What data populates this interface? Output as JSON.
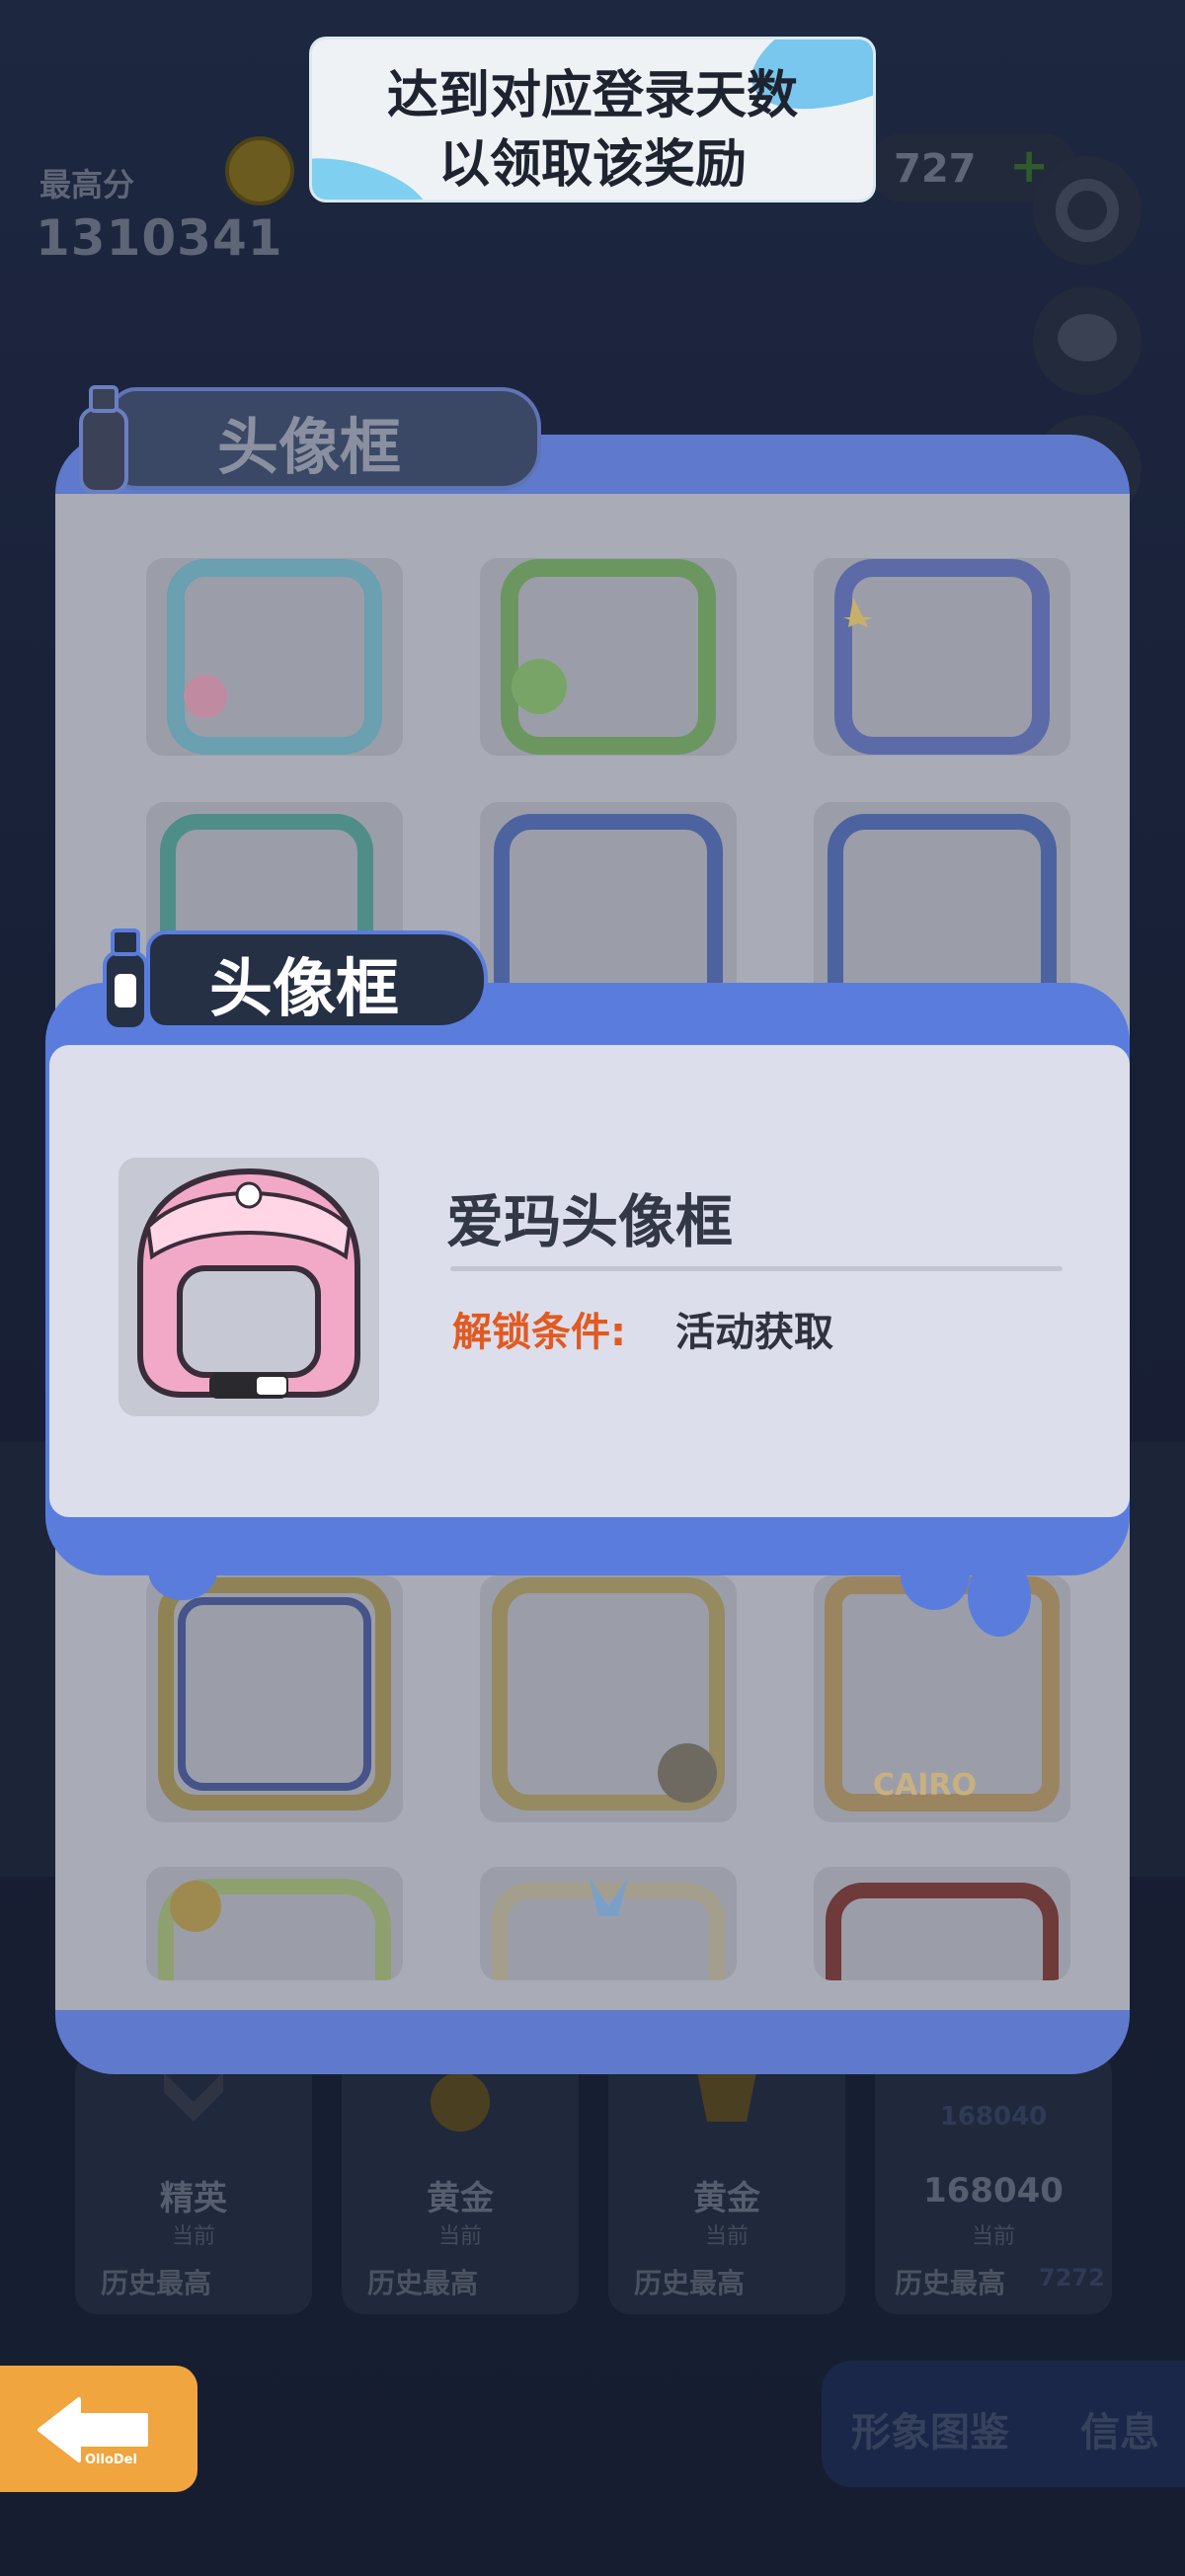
{
  "tooltip": {
    "line1": "达到对应登录天数",
    "line2": "以领取该奖励"
  },
  "background": {
    "high_score_label": "最高分",
    "high_score_value": "1310341",
    "currency_value": "727",
    "currency_plus": "+",
    "ranks": [
      {
        "name": "精英",
        "sub": "当前",
        "history": "历史最高"
      },
      {
        "name": "黄金",
        "sub": "当前",
        "history": "历史最高"
      },
      {
        "name": "黄金",
        "sub": "当前",
        "history": "历史最高"
      },
      {
        "name": "168040",
        "sub": "当前",
        "history": "历史最高",
        "badge": "168040",
        "history_value": "7272"
      }
    ],
    "tabs": [
      "形象图鉴",
      "信息"
    ]
  },
  "back_panel": {
    "title": "头像框"
  },
  "modal": {
    "title": "头像框",
    "item_name": "爱玛头像框",
    "condition_label": "解锁条件:",
    "condition_value": "活动获取"
  },
  "back_button": {
    "brand": "OlloDel"
  },
  "colors": {
    "accent_blue": "#5a7ddd",
    "condition_orange": "#e25a22",
    "back_button": "#f0a53e"
  }
}
